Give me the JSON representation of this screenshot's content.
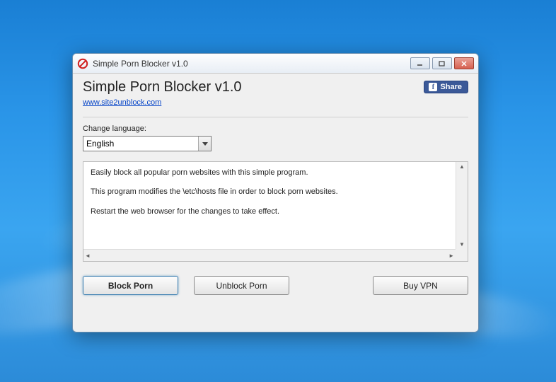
{
  "window": {
    "title": "Simple Porn Blocker v1.0"
  },
  "header": {
    "app_title": "Simple Porn Blocker v1.0",
    "site_link": "www.site2unblock.com",
    "share_label": "Share"
  },
  "lang": {
    "label": "Change language:",
    "selected": "English"
  },
  "info": {
    "line1": "Easily block all popular porn websites with this simple program.",
    "line2": "This program modifies the \\etc\\hosts file in order to block porn websites.",
    "line3": "Restart the web browser for the changes to take effect."
  },
  "buttons": {
    "block": "Block Porn",
    "unblock": "Unblock Porn",
    "buyvpn": "Buy VPN"
  }
}
